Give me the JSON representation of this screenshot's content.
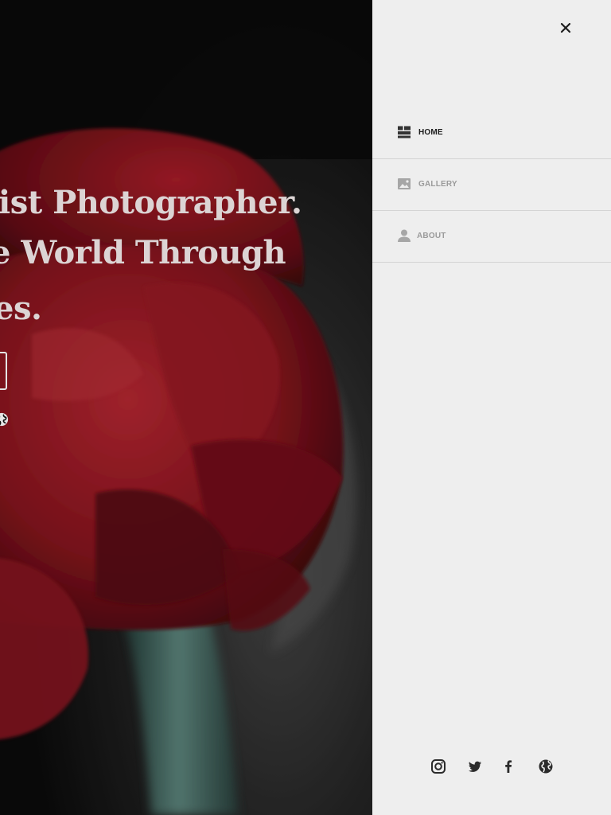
{
  "hero": {
    "line1": "ist Photographer.",
    "line2": "e World Through",
    "line3": "es."
  },
  "menu": {
    "close_icon": "close-icon",
    "items": [
      {
        "label": "HOME",
        "icon": "home-grid-icon",
        "active": true
      },
      {
        "label": "GALLERY",
        "icon": "image-icon",
        "active": false
      },
      {
        "label": "ABOUT",
        "icon": "person-icon",
        "active": false
      }
    ]
  },
  "social": {
    "icons": [
      "instagram-icon",
      "twitter-icon",
      "facebook-icon",
      "globe-icon"
    ]
  },
  "colors": {
    "panel_background": "#eeeeee",
    "active_text": "#1c1c1c",
    "inactive_text": "#9a9a9a",
    "icon_dark": "#333333",
    "icon_muted": "#a6a6a6",
    "rose_red": "#9b1b24"
  }
}
